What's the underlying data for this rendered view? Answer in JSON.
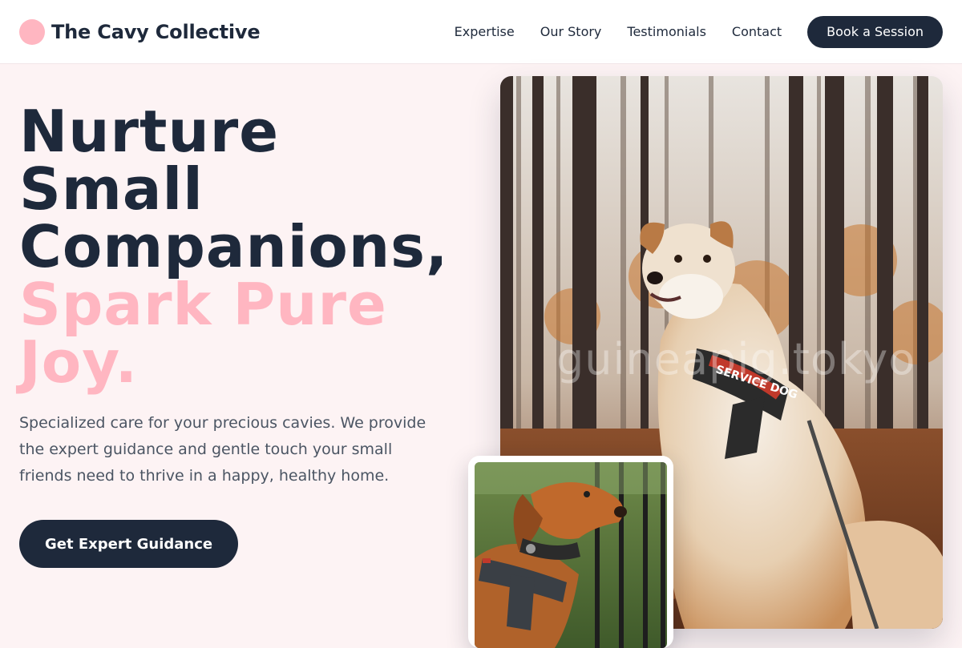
{
  "header": {
    "brand": "The Cavy Collective",
    "nav": [
      "Expertise",
      "Our Story",
      "Testimonials",
      "Contact"
    ],
    "cta": "Book a Session"
  },
  "hero": {
    "headline_lines": [
      "Nurture",
      "Small",
      "Companions,"
    ],
    "accent_lines": [
      "Spark Pure",
      "Joy."
    ],
    "description": "Specialized care for your precious cavies. We provide the expert guidance and gentle touch your small friends need to thrive in a happy, healthy home.",
    "cta": "Get Expert Guidance"
  },
  "images": {
    "main_watermark": "guineapig.tokyo",
    "main_harness_text": "SERVICE DOG"
  },
  "colors": {
    "brand_dark": "#1e293b",
    "accent_pink": "#ffb6c1",
    "page_bg": "#fdf3f4"
  }
}
